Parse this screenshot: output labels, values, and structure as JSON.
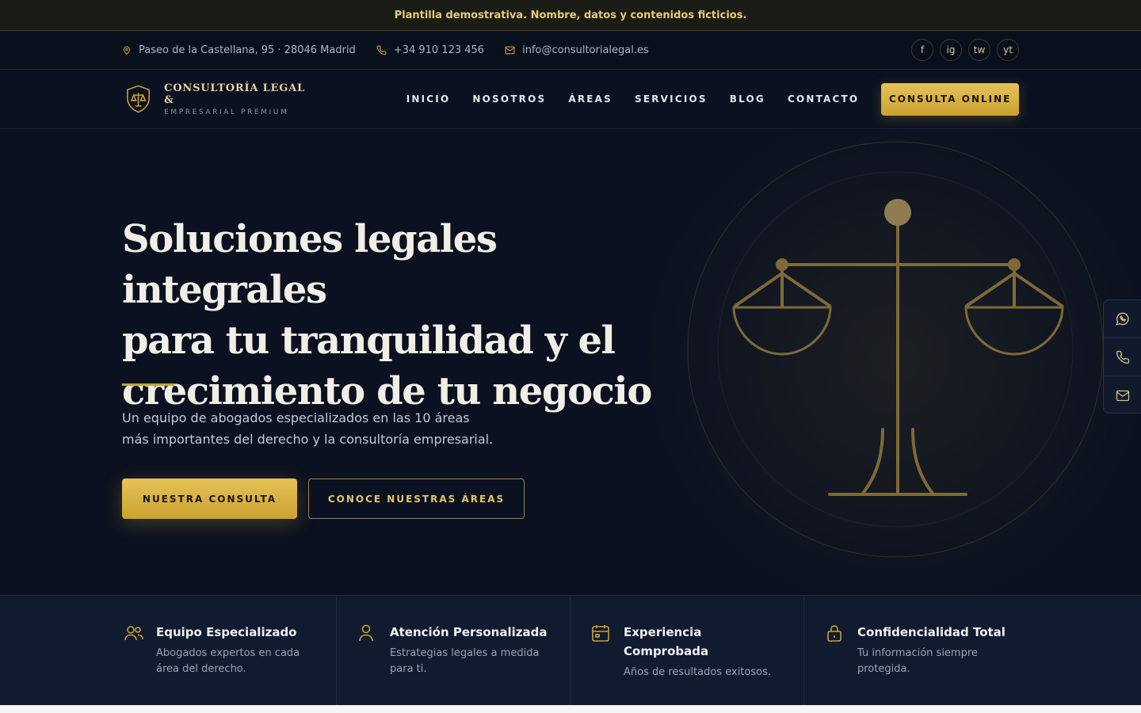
{
  "demo_notice": "Plantilla demostrativa. Nombre, datos y contenidos ficticios.",
  "topbar": {
    "address": "Paseo de la Castellana, 95 · 28046 Madrid",
    "phone": "+34 910 123 456",
    "email": "info@consultorialegal.es",
    "socials": [
      "f",
      "ig",
      "tw",
      "yt"
    ]
  },
  "brand": {
    "name": "CONSULTORÍA LEGAL &",
    "sub": "EMPRESARIAL PREMIUM"
  },
  "nav": {
    "items": [
      "INICIO",
      "NOSOTROS",
      "ÁREAS",
      "SERVICIOS",
      "BLOG",
      "CONTACTO"
    ],
    "cta": "CONSULTA ONLINE"
  },
  "hero": {
    "title_lines": [
      "Soluciones legales integrales",
      "para tu tranquilidad y el",
      "crecimiento de tu negocio"
    ],
    "desc_lines": [
      "Un equipo de abogados especializados en las 10 áreas",
      "más importantes del derecho y la consultoría empresarial."
    ],
    "btn_primary": "NUESTRA CONSULTA",
    "btn_secondary": "CONOCE NUESTRAS ÁREAS"
  },
  "features": [
    {
      "icon": "users-icon",
      "title": "Equipo Especializado",
      "text": "Abogados expertos en cada área del derecho."
    },
    {
      "icon": "user-icon",
      "title": "Atención Personalizada",
      "text": "Estrategias legales a medida para ti."
    },
    {
      "icon": "calendar-icon",
      "title": "Experiencia Comprobada",
      "text": "Años de resultados exitosos."
    },
    {
      "icon": "lock-icon",
      "title": "Confidencialidad Total",
      "text": "Tu información siempre protegida."
    }
  ],
  "colors": {
    "gold": "#c9a230",
    "navy": "#0b1120"
  }
}
